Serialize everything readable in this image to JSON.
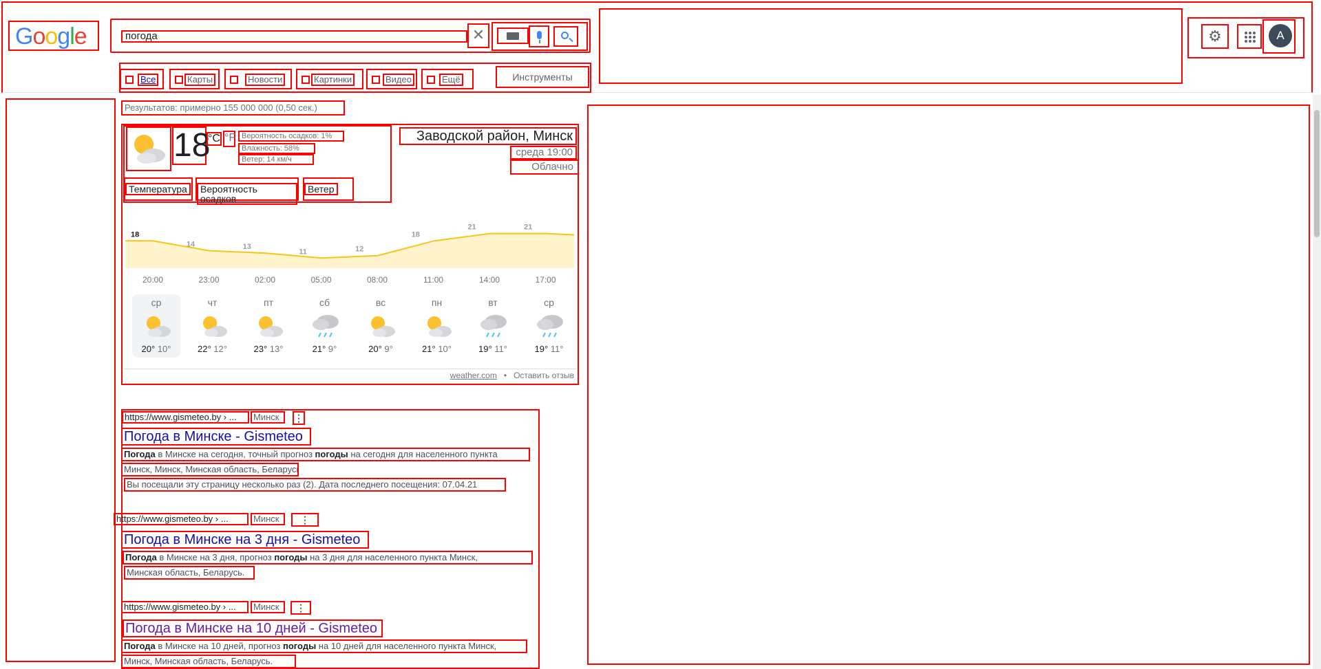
{
  "header": {
    "logo": "Google",
    "search_value": "погода",
    "clear_symbol": "✕",
    "gear_symbol": "⚙",
    "avatar_letter": "A"
  },
  "tabs": [
    {
      "label": "Все",
      "icon": "search-icon",
      "active": true
    },
    {
      "label": "Карты",
      "icon": "map-pin-icon"
    },
    {
      "label": "Новости",
      "icon": "news-icon"
    },
    {
      "label": "Картинки",
      "icon": "image-icon"
    },
    {
      "label": "Видео",
      "icon": "video-icon"
    },
    {
      "label": "Ещё",
      "icon": "more-vert-icon"
    }
  ],
  "tools_label": "Инструменты",
  "results_stats": "Результатов: примерно 155 000 000 (0,50 сек.)",
  "weather": {
    "temp": "18",
    "unit_c": "°C",
    "unit_f": "°F",
    "precip": "Вероятность осадков: 1%",
    "humidity": "Влажность: 58%",
    "wind": "Ветер: 14 км/ч",
    "location": "Заводской район, Минск",
    "time": "среда 19:00",
    "condition": "Облачно",
    "tabs": [
      "Температура",
      "Вероятность осадков",
      "Ветер"
    ],
    "hourly": [
      {
        "time": "20:00",
        "temp": 18
      },
      {
        "time": "23:00",
        "temp": 14
      },
      {
        "time": "02:00",
        "temp": 13
      },
      {
        "time": "05:00",
        "temp": 11
      },
      {
        "time": "08:00",
        "temp": 12
      },
      {
        "time": "11:00",
        "temp": 18
      },
      {
        "time": "14:00",
        "temp": 21
      },
      {
        "time": "17:00",
        "temp": 21
      }
    ],
    "days": [
      {
        "name": "ср",
        "hi": "20",
        "lo": "10",
        "icon": "partly-cloudy-icon"
      },
      {
        "name": "чт",
        "hi": "22",
        "lo": "12",
        "icon": "partly-cloudy-icon"
      },
      {
        "name": "пт",
        "hi": "23",
        "lo": "13",
        "icon": "partly-cloudy-icon"
      },
      {
        "name": "сб",
        "hi": "21",
        "lo": "9",
        "icon": "rain-icon"
      },
      {
        "name": "вс",
        "hi": "20",
        "lo": "9",
        "icon": "partly-cloudy-icon"
      },
      {
        "name": "пн",
        "hi": "21",
        "lo": "10",
        "icon": "partly-cloudy-icon"
      },
      {
        "name": "вт",
        "hi": "19",
        "lo": "11",
        "icon": "rain-icon"
      },
      {
        "name": "ср",
        "hi": "19",
        "lo": "11",
        "icon": "rain-icon"
      }
    ],
    "source": "weather.com",
    "feedback": "Оставить отзыв",
    "dot": "•"
  },
  "results": [
    {
      "url": "https://www.gismeteo.by › ...",
      "crumb": "Минск",
      "title": "Погода в Минске - Gismeteo",
      "snip1_bold": "Погода",
      "snip1_a": " в Минске на сегодня, точный прогноз ",
      "snip1_bold2": "погоды",
      "snip1_b": " на сегодня для населенного пункта",
      "snip2": "Минск, Минск, Минская область, Беларусь.",
      "snip3": "Вы посещали эту страницу несколько раз (2). Дата последнего посещения: 07.04.21"
    },
    {
      "url": "https://www.gismeteo.by › ...",
      "crumb": "Минск",
      "title": "Погода в Минске на 3 дня - Gismeteo",
      "snip1_bold": "Погода",
      "snip1_a": " в Минске на 3 дня, прогноз ",
      "snip1_bold2": "погоды",
      "snip1_b": " на 3 дня для населенного пункта Минск,",
      "snip2": "Минская область, Беларусь."
    },
    {
      "url": "https://www.gismeteo.by › ...",
      "crumb": "Минск",
      "title": "Погода в Минске на 10 дней - Gismeteo",
      "snip1_bold": "Погода",
      "snip1_a": " в Минске на 10 дней, прогноз ",
      "snip1_bold2": "погоды",
      "snip1_b": " на 10 дней для населенного пункта Минск,",
      "snip2": "Минск, Минская область, Беларусь."
    }
  ],
  "more_symbol": "⋮",
  "colors": {
    "link": "#1a0dab",
    "accent": "#4285f4",
    "chart_line": "#f5c518",
    "chart_fill": "#fff4cc",
    "annotation": "#ff0000"
  }
}
